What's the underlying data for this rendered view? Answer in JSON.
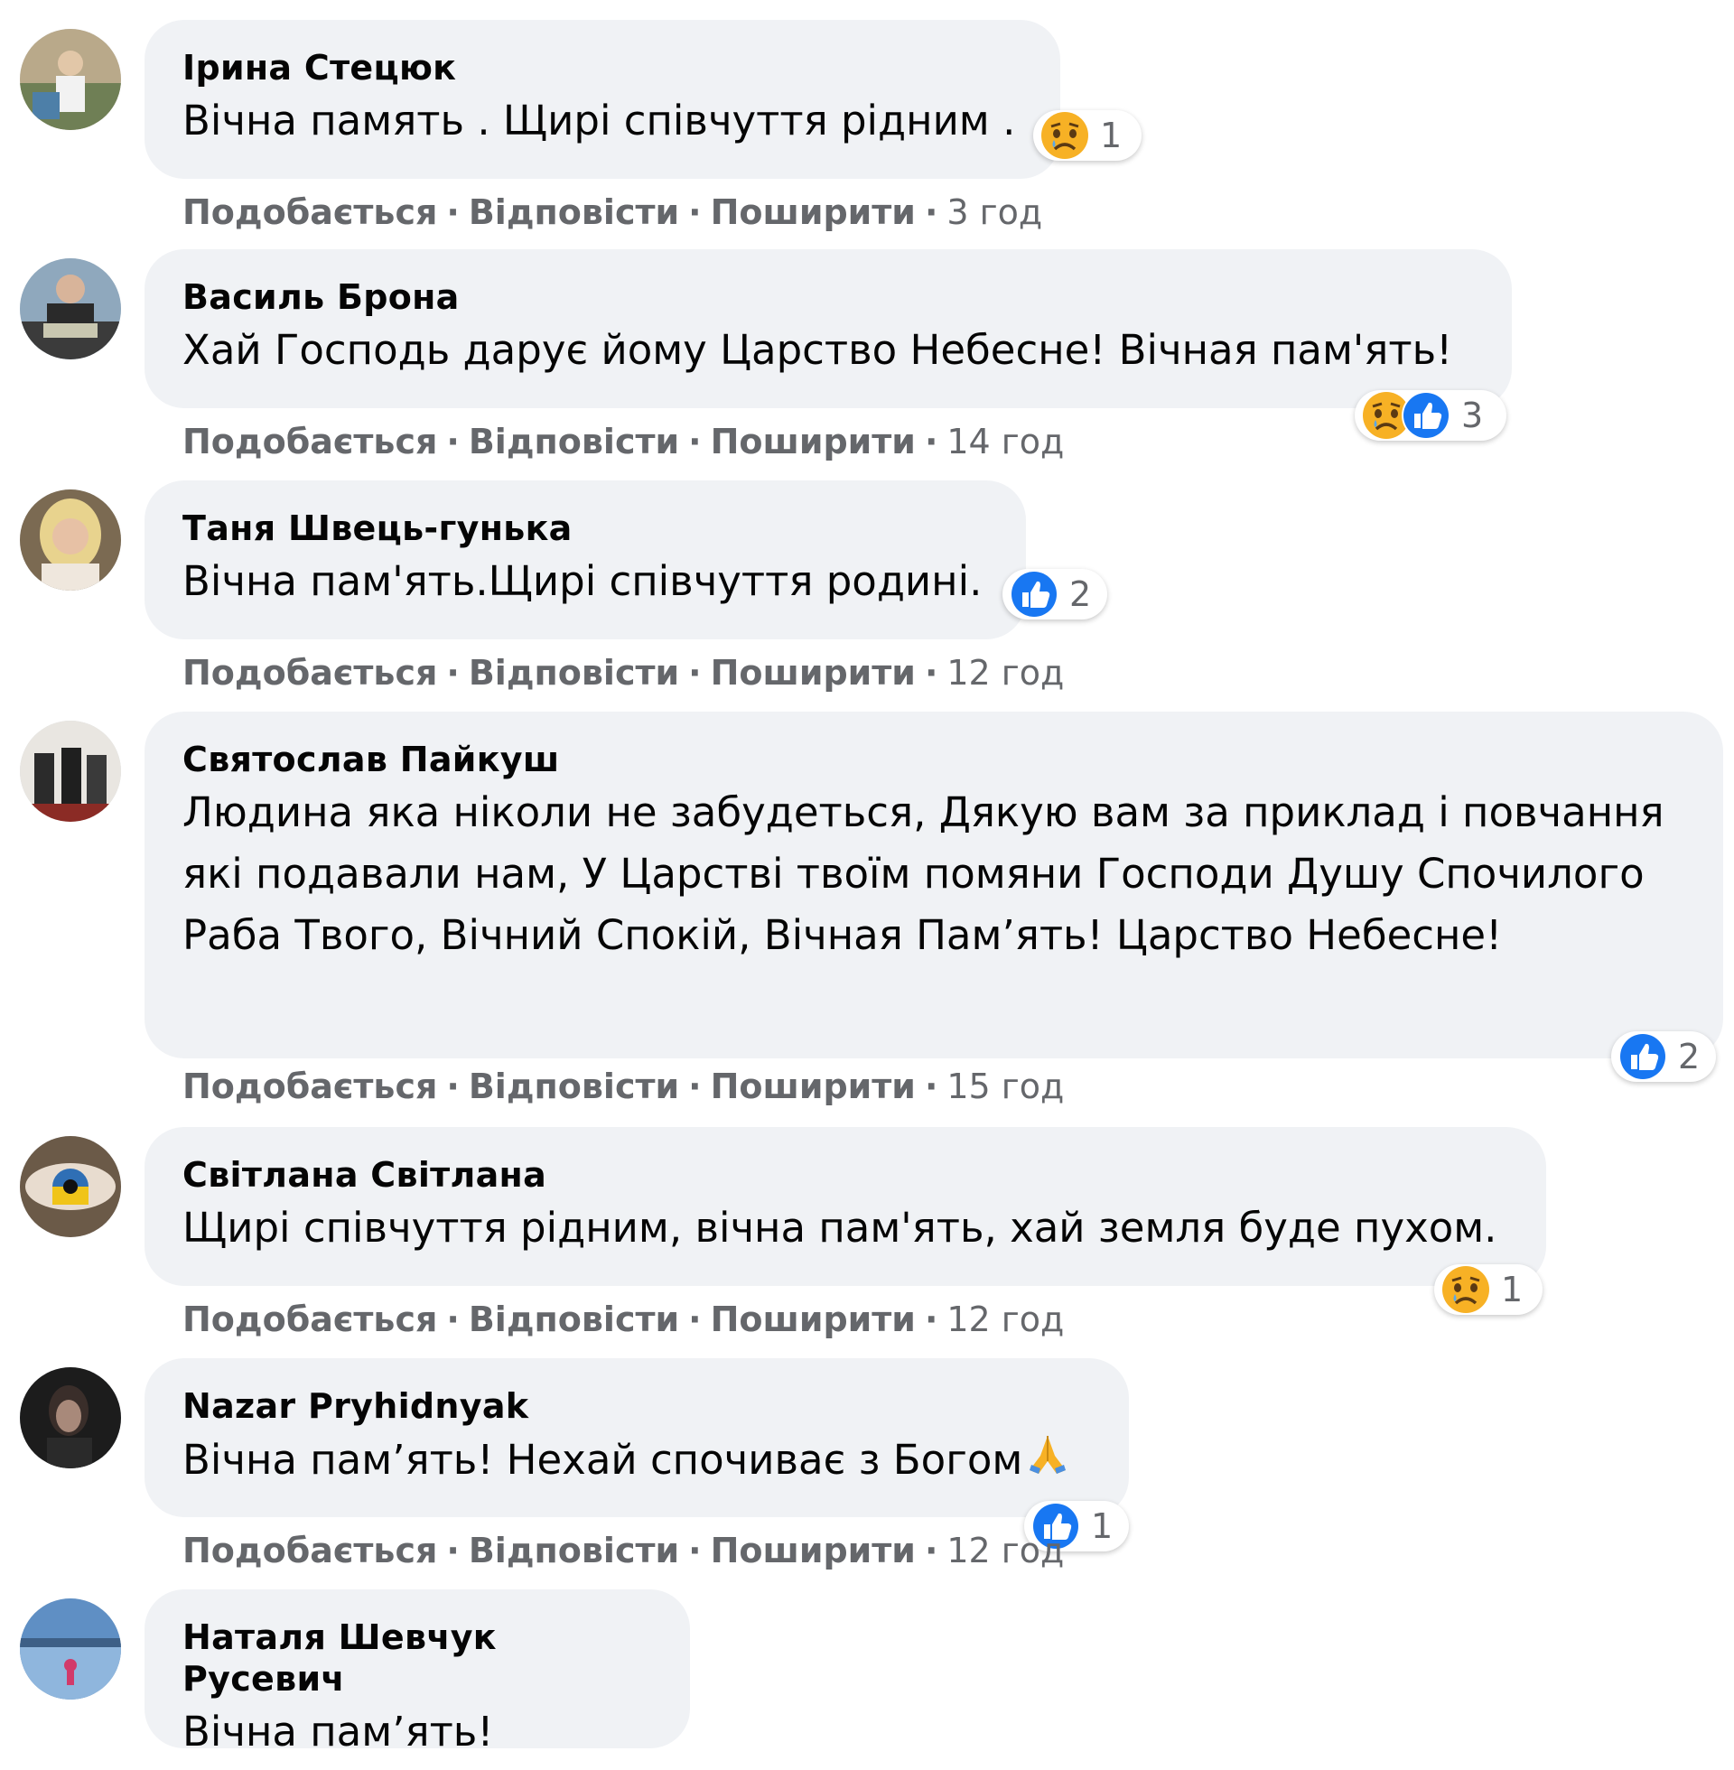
{
  "labels": {
    "like": "Подобається",
    "reply": "Відповісти",
    "share": "Поширити",
    "separator": "·"
  },
  "comments": [
    {
      "author": "Ірина Стецюк",
      "text": "Вічна память . Щирі співчуття рідним .",
      "reactions": [
        "sad"
      ],
      "reaction_count": "1",
      "time": "3 год"
    },
    {
      "author": "Василь Брона",
      "text": "Хай Господь дарує йому Царство Небесне! Вічная пам'ять!",
      "reactions": [
        "sad",
        "like"
      ],
      "reaction_count": "3",
      "time": "14 год"
    },
    {
      "author": "Таня Швець-гунька",
      "text": "Вічна пам'ять.Щирі співчуття родині.",
      "reactions": [
        "like"
      ],
      "reaction_count": "2",
      "time": "12 год"
    },
    {
      "author": "Святослав Пайкуш",
      "text": "Людина яка ніколи не забудеться, Дякую вам за приклад і повчання які подавали нам, У Царстві твоїм помяни Господи Душу Спочилого Раба Твого, Вічний Спокій, Вічная Пам’ять! Царство Небесне!",
      "reactions": [
        "like"
      ],
      "reaction_count": "2",
      "time": "15 год"
    },
    {
      "author": "Світлана Світлана",
      "text": "Щирі співчуття рідним, вічна пам'ять, хай земля буде пухом.",
      "reactions": [
        "sad"
      ],
      "reaction_count": "1",
      "time": "12 год"
    },
    {
      "author": "Nazar Pryhidnyak",
      "text": "Вічна пам’ять! Нехай спочиває з Богом",
      "text_emoji": "folded-hands-emoji",
      "reactions": [
        "like"
      ],
      "reaction_count": "1",
      "time": "12 год"
    },
    {
      "author": "Наталя Шевчук Русевич",
      "text": "Вічна пам’ять!"
    }
  ],
  "colors": {
    "bubble": "#f0f2f5",
    "meta_text": "#65676b",
    "like_blue": "#1877f2",
    "sad_yellow": "#f7b125"
  }
}
